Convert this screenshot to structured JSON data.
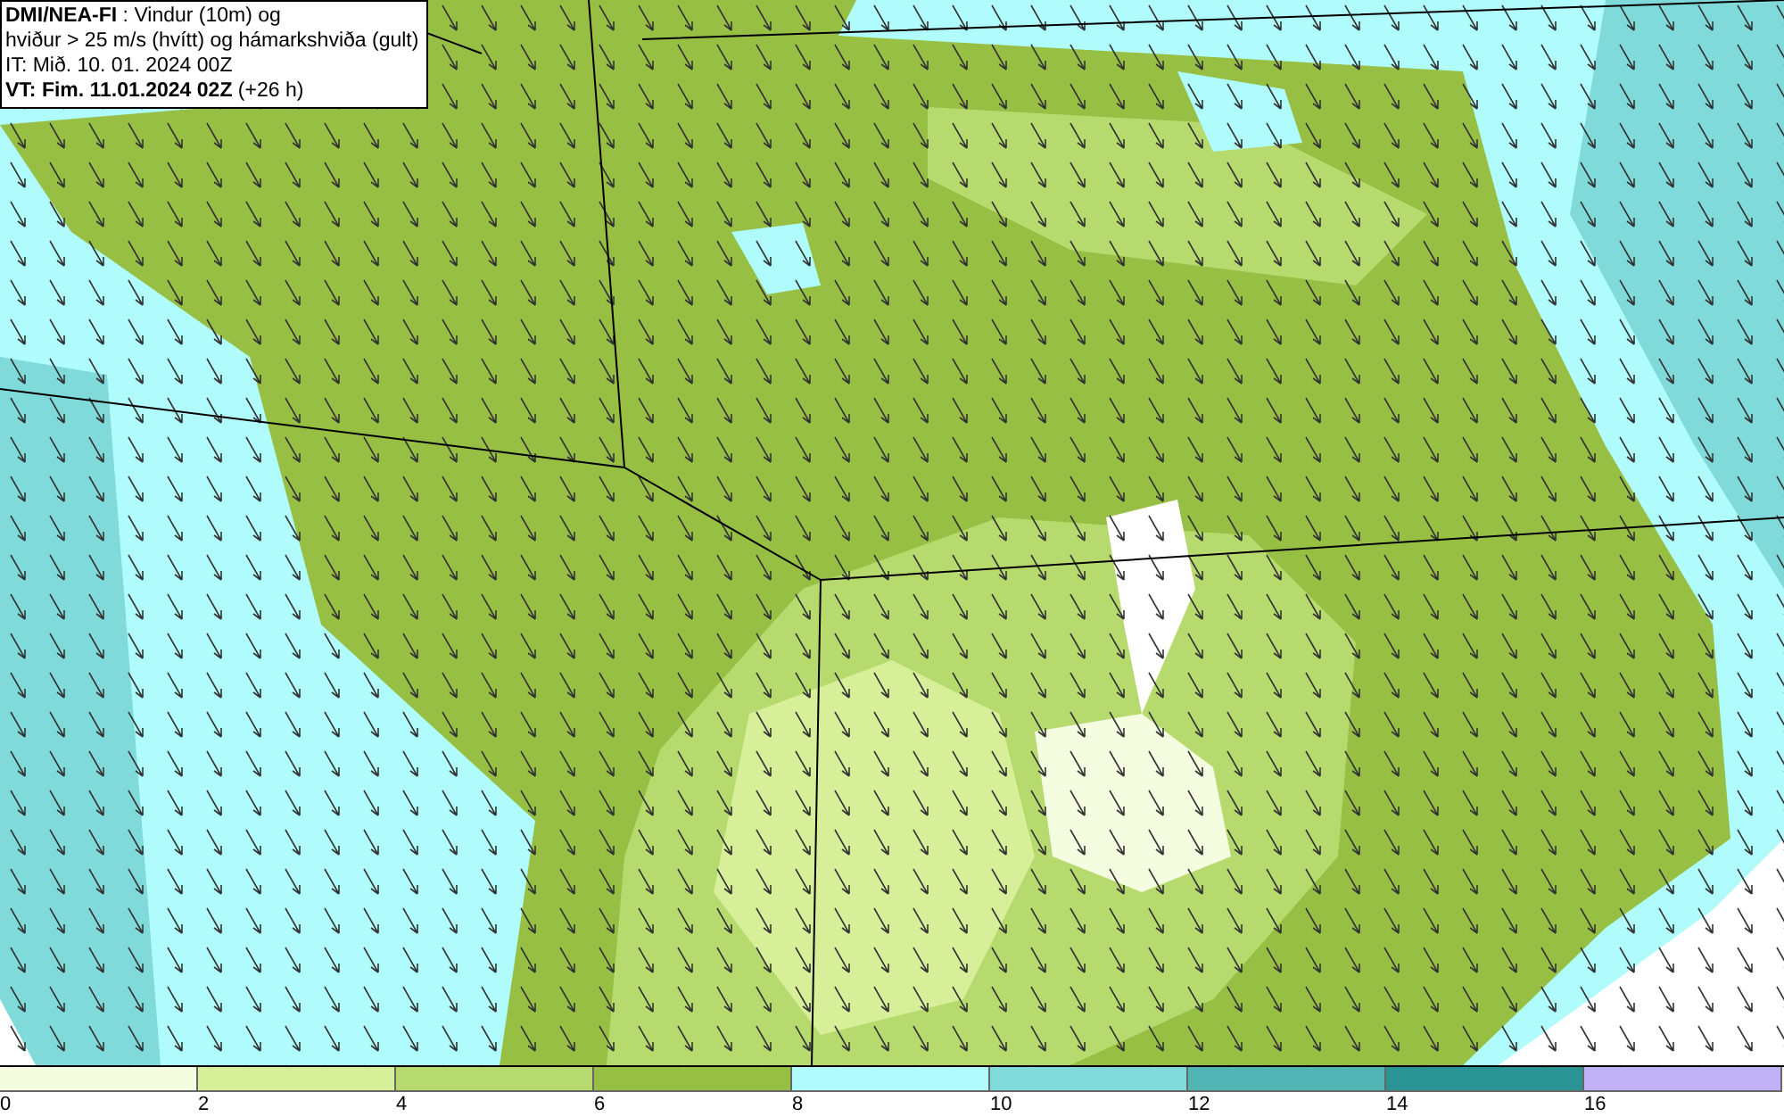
{
  "info_box": {
    "lines": [
      "**DMI/NEA-FI** : Vindur (10m) og",
      "hviður > 25 m/s (hvítt) og hámarkshviða (gult)",
      "IT: Mið. 10. 01. 2024 00Z",
      "**VT: Fim. 11.01.2024 02Z** (+26 h)"
    ]
  },
  "legend": [
    {
      "label": "0",
      "color": "#f4fde0"
    },
    {
      "label": "2",
      "color": "#d8ef9a"
    },
    {
      "label": "4",
      "color": "#b6da6e"
    },
    {
      "label": "6",
      "color": "#96bf44"
    },
    {
      "label": "8",
      "color": "#b0fcfc"
    },
    {
      "label": "10",
      "color": "#80dada"
    },
    {
      "label": "12",
      "color": "#52b5b5"
    },
    {
      "label": "14",
      "color": "#2a9494"
    },
    {
      "label": "16",
      "color": "#c0b0f4"
    }
  ]
}
